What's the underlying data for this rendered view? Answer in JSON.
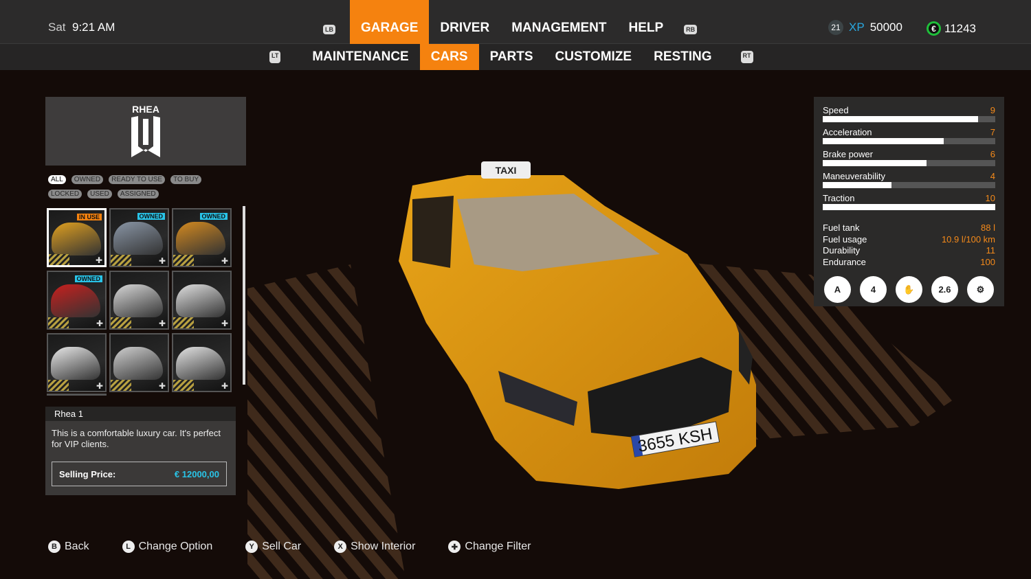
{
  "header": {
    "day": "Sat",
    "time": "9:21 AM",
    "lb_icon": "LB",
    "rb_icon": "RB",
    "tabs": [
      {
        "label": "GARAGE",
        "active": true
      },
      {
        "label": "DRIVER"
      },
      {
        "label": "MANAGEMENT"
      },
      {
        "label": "HELP"
      }
    ],
    "level": "21",
    "xp_label": "XP",
    "xp": "50000",
    "money_icon": "€",
    "money": "11243"
  },
  "subnav": {
    "lt_icon": "LT",
    "rt_icon": "RT",
    "tabs": [
      {
        "label": "MAINTENANCE"
      },
      {
        "label": "CARS",
        "active": true
      },
      {
        "label": "PARTS"
      },
      {
        "label": "CUSTOMIZE"
      },
      {
        "label": "RESTING"
      }
    ]
  },
  "brand": {
    "name": "RHEA"
  },
  "filters": [
    {
      "label": "ALL",
      "active": true
    },
    {
      "label": "OWNED"
    },
    {
      "label": "READY TO USE"
    },
    {
      "label": "TO BUY"
    },
    {
      "label": "LOCKED"
    },
    {
      "label": "USED"
    },
    {
      "label": "ASSIGNED"
    }
  ],
  "cars": [
    {
      "badge": "IN USE",
      "badge_color": "#f5820f",
      "color": "#e0a020",
      "selected": true
    },
    {
      "badge": "OWNED",
      "badge_color": "#29c4e8",
      "color": "#8a96a6"
    },
    {
      "badge": "OWNED",
      "badge_color": "#29c4e8",
      "color": "#d48a20"
    },
    {
      "badge": "OWNED",
      "badge_color": "#29c4e8",
      "color": "#c8201e"
    },
    {
      "badge": "",
      "color": "#d8d8d8"
    },
    {
      "badge": "",
      "color": "#e0e0e0"
    },
    {
      "badge": "",
      "color": "#e8e8e8"
    },
    {
      "badge": "",
      "color": "#d0d0d0"
    },
    {
      "badge": "",
      "color": "#e4e4e4"
    }
  ],
  "info": {
    "name": "Rhea  1",
    "description": "This is a comfortable luxury car. It's perfect for VIP clients.",
    "price_label": "Selling Price:",
    "price": "€ 12000,00"
  },
  "stats": {
    "bars": [
      {
        "label": "Speed",
        "value": "9",
        "fill": 0.9
      },
      {
        "label": "Acceleration",
        "value": "7",
        "fill": 0.7
      },
      {
        "label": "Brake power",
        "value": "6",
        "fill": 0.6
      },
      {
        "label": "Maneuverability",
        "value": "4",
        "fill": 0.4
      },
      {
        "label": "Traction",
        "value": "10",
        "fill": 1.0
      }
    ],
    "specs": [
      {
        "label": "Fuel tank",
        "value": "88 l"
      },
      {
        "label": "Fuel usage",
        "value": "10.9 l/100 km"
      },
      {
        "label": "Durability",
        "value": "11"
      },
      {
        "label": "Endurance",
        "value": "100"
      }
    ],
    "feature_icons": [
      {
        "name": "automatic-transmission-icon",
        "text": "A"
      },
      {
        "name": "seats-4-icon",
        "text": "4"
      },
      {
        "name": "comfort-icon",
        "text": "✋"
      },
      {
        "name": "weight-icon",
        "text": "2.6"
      },
      {
        "name": "engine-icon",
        "text": "⚙"
      }
    ]
  },
  "car_view": {
    "roof_sign": "TAXI",
    "plate": "3655 KSH",
    "plate_country": "E",
    "body_color": "#e29a12"
  },
  "footer": [
    {
      "button": "B",
      "label": "Back"
    },
    {
      "button": "L",
      "label": "Change Option"
    },
    {
      "button": "Y",
      "label": "Sell Car"
    },
    {
      "button": "X",
      "label": "Show Interior"
    },
    {
      "button": "✚",
      "label": "Change Filter"
    }
  ],
  "colors": {
    "accent": "#f5820f",
    "price": "#29c4e8",
    "stat_value": "#f58a1a",
    "money_ring": "#1fbf3a"
  }
}
